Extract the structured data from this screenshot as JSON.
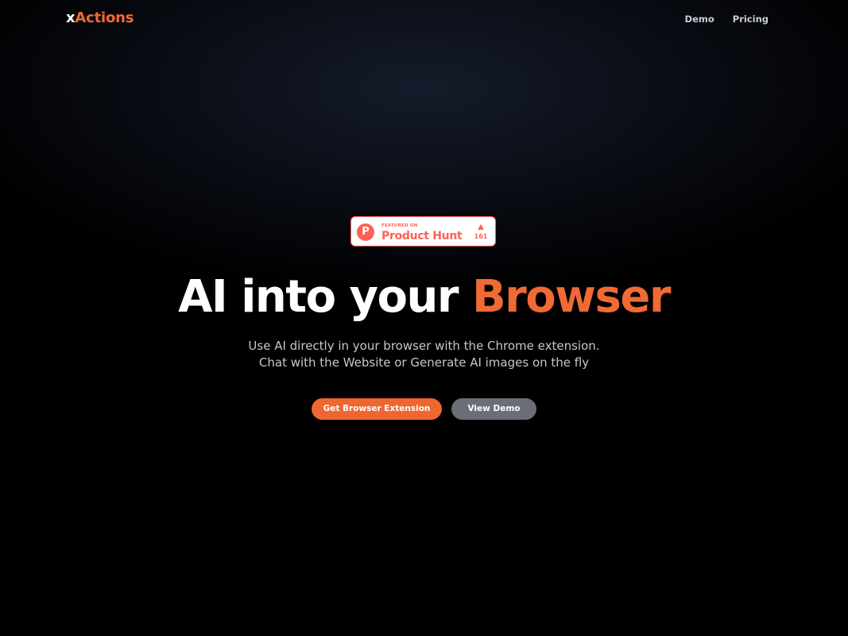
{
  "brand": {
    "logo_prefix": "x",
    "logo_rest": "Actions",
    "accent_color": "#f06a35"
  },
  "nav": {
    "items": [
      {
        "label": "Demo"
      },
      {
        "label": "Pricing"
      }
    ]
  },
  "product_hunt_badge": {
    "featured_label": "FEATURED ON",
    "name": "Product Hunt",
    "logo_letter": "P",
    "upvotes": "161",
    "color": "#ff6154"
  },
  "hero": {
    "headline_main": "AI into your ",
    "headline_accent": "Browser",
    "subtitle_line1": "Use AI directly in your browser with the Chrome extension.",
    "subtitle_line2": "Chat with the Website or Generate AI images on the fly"
  },
  "cta": {
    "primary_label": "Get Browser Extension",
    "secondary_label": "View Demo"
  }
}
